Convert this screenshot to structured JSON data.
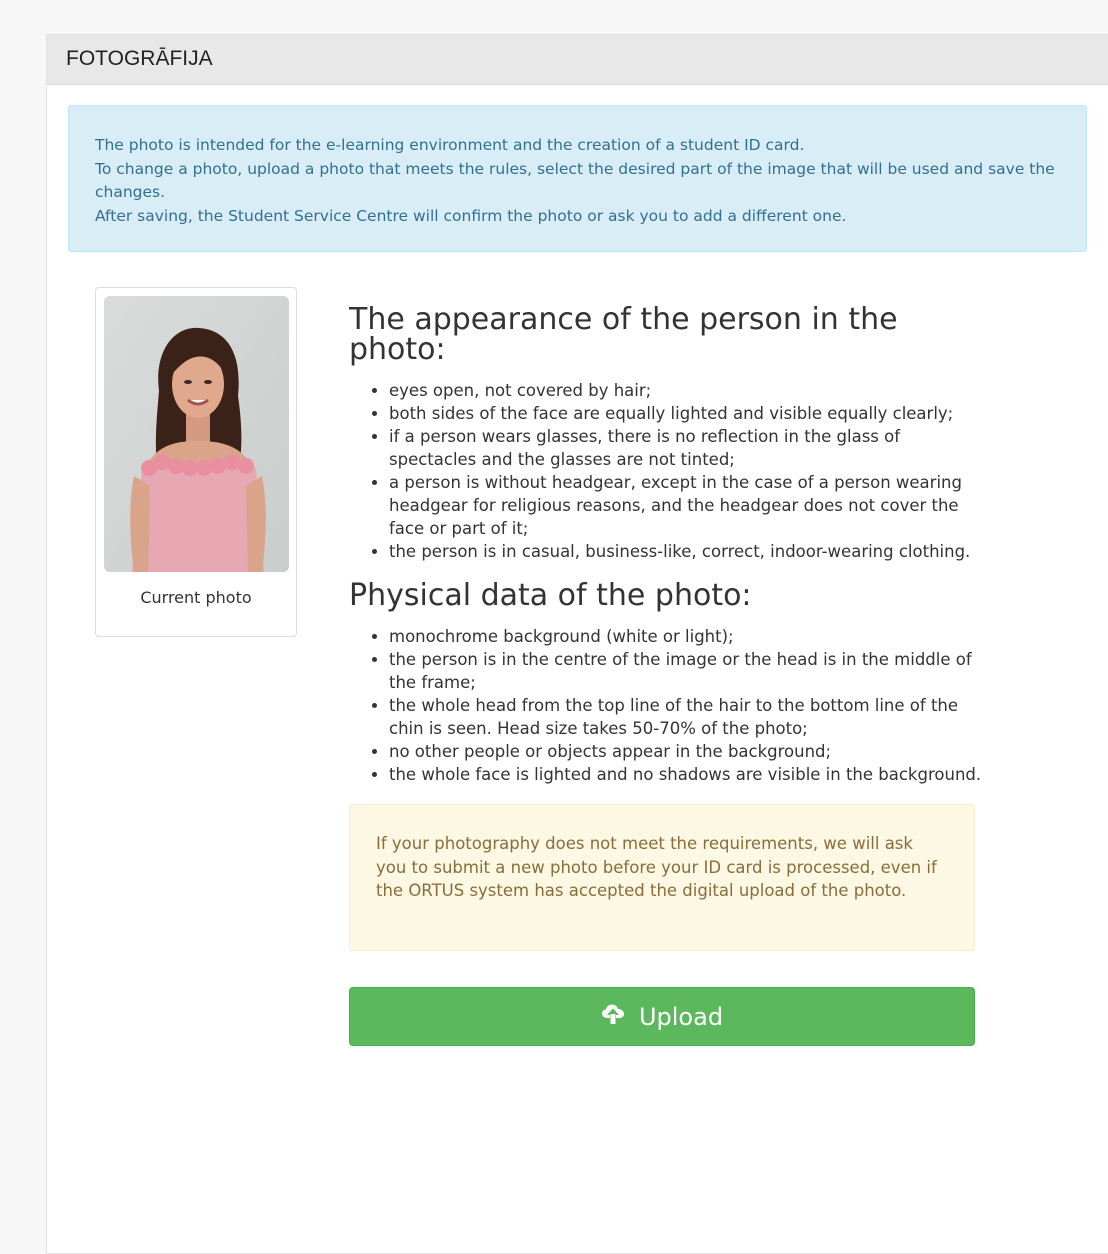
{
  "panel": {
    "title": "FOTOGRĀFIJA"
  },
  "info": {
    "line1": "The photo is intended for the e-learning environment and the creation of a student ID card.",
    "line2": "To change a photo, upload a photo that meets the rules, select the desired part of the image that will be used and save the changes.",
    "line3": "After saving, the Student Service Centre will confirm the photo or ask you to add a different one."
  },
  "current_photo": {
    "caption": "Current photo"
  },
  "appearance": {
    "heading": "The appearance of the person in the photo:",
    "items": [
      "eyes open, not covered by hair;",
      "both sides of the face are equally lighted and visible equally clearly;",
      "if a person wears glasses, there is no reflection in the glass of spectacles and the glasses are not tinted;",
      "a person is without headgear, except in the case of a person wearing headgear for religious reasons, and the headgear does not cover the face or part of it;",
      "the person is in casual, business-like, correct, indoor-wearing clothing."
    ]
  },
  "physical": {
    "heading": "Physical data of the photo:",
    "items": [
      "monochrome background (white or light);",
      "the person is in the centre of the image or the head is in the middle of the frame;",
      "the whole head from the top line of the hair to the bottom line of the chin is seen. Head size takes 50-70% of the photo;",
      "no other people or objects appear in the background;",
      "the whole face is lighted and no shadows are visible in the background."
    ]
  },
  "warning": {
    "text": "If your photography does not meet the requirements, we will ask you to submit a new photo before your ID card is processed, even if the ORTUS system has accepted the digital upload of the photo."
  },
  "upload": {
    "label": "Upload",
    "icon": "cloud-upload-icon",
    "color": "#5cb85c"
  }
}
